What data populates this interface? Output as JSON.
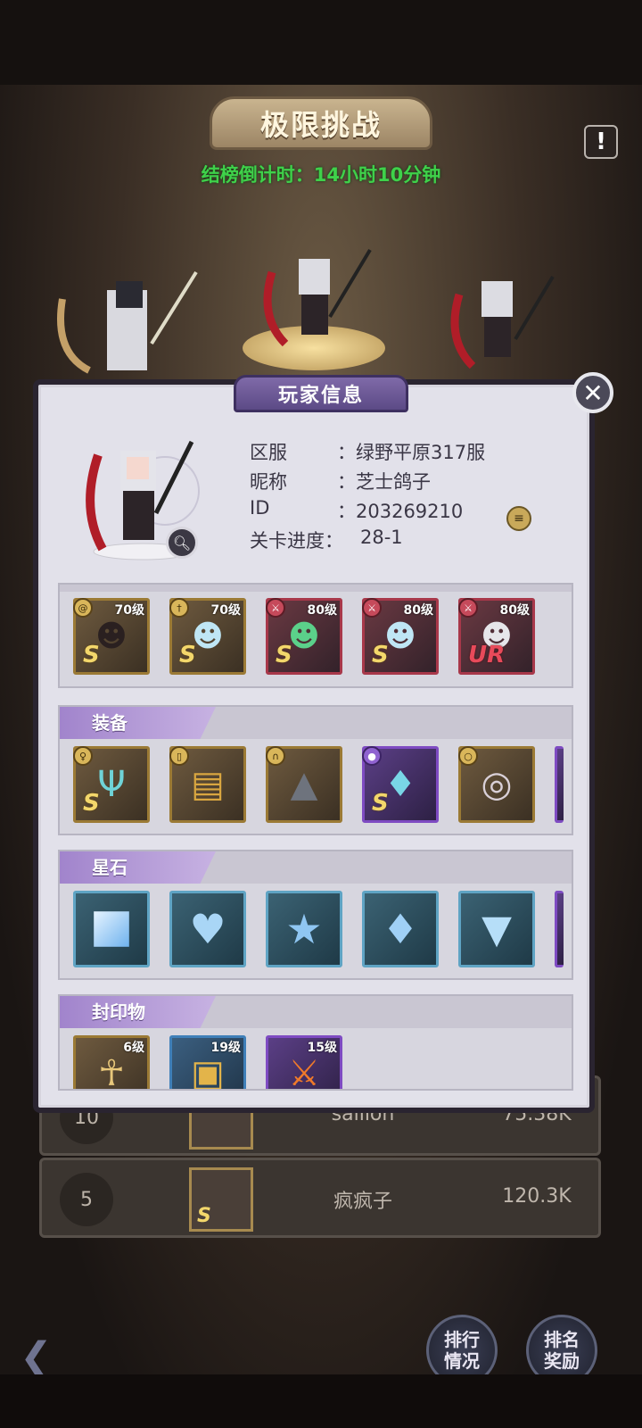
{
  "header": {
    "title": "极限挑战",
    "countdown": "结榜倒计时：14小时10分钟"
  },
  "ranking": {
    "rows": [
      {
        "rank": "10",
        "name": "sailion",
        "score": "75.38K"
      },
      {
        "rank": "5",
        "name": "疯疯子",
        "score": "120.3K"
      }
    ]
  },
  "bottom_buttons": {
    "ranking_status": "排行\n情况",
    "ranking_reward": "排名\n奖励"
  },
  "modal": {
    "title": "玩家信息",
    "close_label": "✕",
    "info": {
      "server_label": "区服",
      "server_value": "：绿野平原317服",
      "nickname_label": "昵称",
      "nickname_value": "：芝士鸽子",
      "id_label": "ID",
      "id_value": "：203269210",
      "progress_label": "关卡进度：",
      "progress_value": "28-1"
    },
    "heroes": [
      {
        "level": "70级",
        "grade": "S",
        "frame": "gold",
        "class_icon": "swirl-icon"
      },
      {
        "level": "70级",
        "grade": "S",
        "frame": "gold",
        "class_icon": "staff-icon"
      },
      {
        "level": "80级",
        "grade": "S",
        "frame": "red",
        "class_icon": "sword-icon"
      },
      {
        "level": "80级",
        "grade": "S",
        "frame": "red",
        "class_icon": "sword-icon"
      },
      {
        "level": "80级",
        "grade": "UR",
        "frame": "red",
        "class_icon": "sword-icon"
      }
    ],
    "equipment": {
      "title": "装备",
      "items": [
        {
          "icon": "trident-icon",
          "grade": "S",
          "frame": "gold"
        },
        {
          "icon": "book-icon",
          "grade": "",
          "frame": "gold"
        },
        {
          "icon": "witch-hat-icon",
          "grade": "",
          "frame": "gold"
        },
        {
          "icon": "armor-icon",
          "grade": "S",
          "frame": "purple"
        },
        {
          "icon": "ring-icon",
          "grade": "",
          "frame": "gold"
        }
      ]
    },
    "starstones": {
      "title": "星石",
      "items": [
        {
          "icon": "square-gem-icon"
        },
        {
          "icon": "heart-gem-icon"
        },
        {
          "icon": "star-gem-icon"
        },
        {
          "icon": "diamond-gem-icon"
        },
        {
          "icon": "shield-gem-icon"
        }
      ]
    },
    "seals": {
      "title": "封印物",
      "items": [
        {
          "level": "6级",
          "icon": "totem-icon",
          "frame": "gold"
        },
        {
          "level": "19级",
          "icon": "relic-box-icon",
          "frame": "blue"
        },
        {
          "level": "15级",
          "icon": "flame-sword-icon",
          "frame": "purple"
        }
      ]
    }
  }
}
